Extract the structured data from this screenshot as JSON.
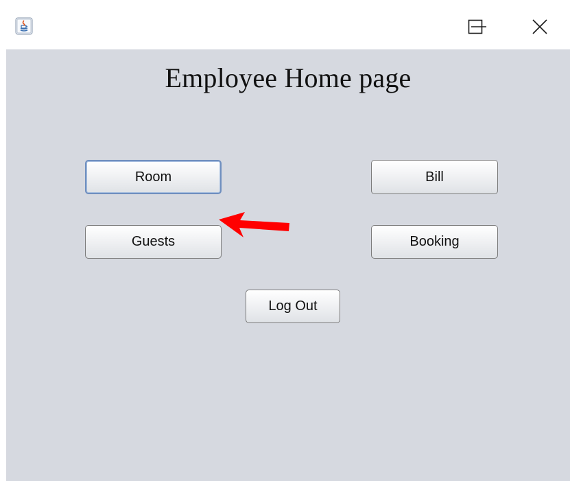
{
  "window": {
    "icon": "java-app-icon",
    "controls": {
      "minimize_icon": "minimize-icon",
      "maximize_icon": "maximize-icon",
      "close_icon": "close-icon"
    }
  },
  "page": {
    "title": "Employee Home page"
  },
  "buttons": {
    "room": "Room",
    "bill": "Bill",
    "guests": "Guests",
    "booking": "Booking",
    "logout": "Log Out"
  },
  "colors": {
    "content_background": "#d6d9e0",
    "annotation_arrow": "#ff0000",
    "focus_border": "#6f8fbf"
  },
  "annotation": {
    "icon": "red-arrow-icon",
    "points_to": "Guests"
  }
}
